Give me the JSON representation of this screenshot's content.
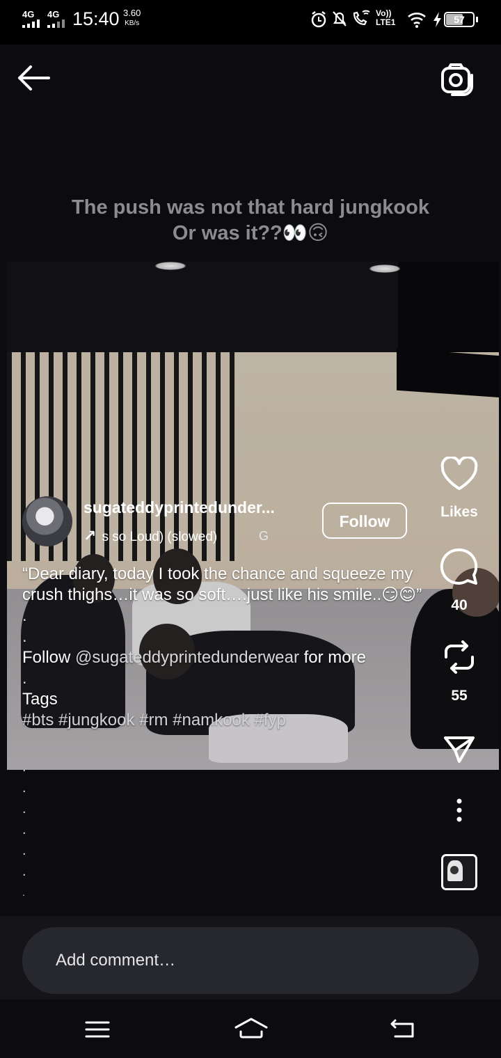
{
  "status_bar": {
    "signal1": "4G",
    "signal2": "4G",
    "time": "15:40",
    "speed_value": "3.60",
    "speed_unit": "KB/s",
    "volte": "Vo)) LTE1",
    "battery": "57"
  },
  "header": {
    "back_icon": "arrow-left-icon",
    "camera_icon": "camera-icon"
  },
  "post": {
    "caption_line1": "The push was not that hard jungkook",
    "caption_line2": "Or was it??👀🙃",
    "username": "sugateddyprintedunder...",
    "music": "s so Loud) (slowed)",
    "music_extra": "G",
    "follow_label": "Follow",
    "description": {
      "line1": "“Dear diary, today I took the chance and squeeze my crush thighs…it was so soft….just like his smile..😏😊”",
      "dot1": ".",
      "dot2": ".",
      "follow_line_prefix": "Follow ",
      "follow_handle": "@sugateddyprintedunderwear",
      "follow_line_suffix": " for more",
      "dot3": ".",
      "tags_label": "Tags",
      "tags": "#bts #jungkook #rm #namkook #fyp"
    },
    "trailing_dots": [
      ".",
      ".",
      ".",
      ".",
      ".",
      ".",
      "."
    ]
  },
  "rail": {
    "likes_label": "Likes",
    "comments_count": "40",
    "reposts_count": "55"
  },
  "comment": {
    "placeholder": "Add comment…"
  }
}
